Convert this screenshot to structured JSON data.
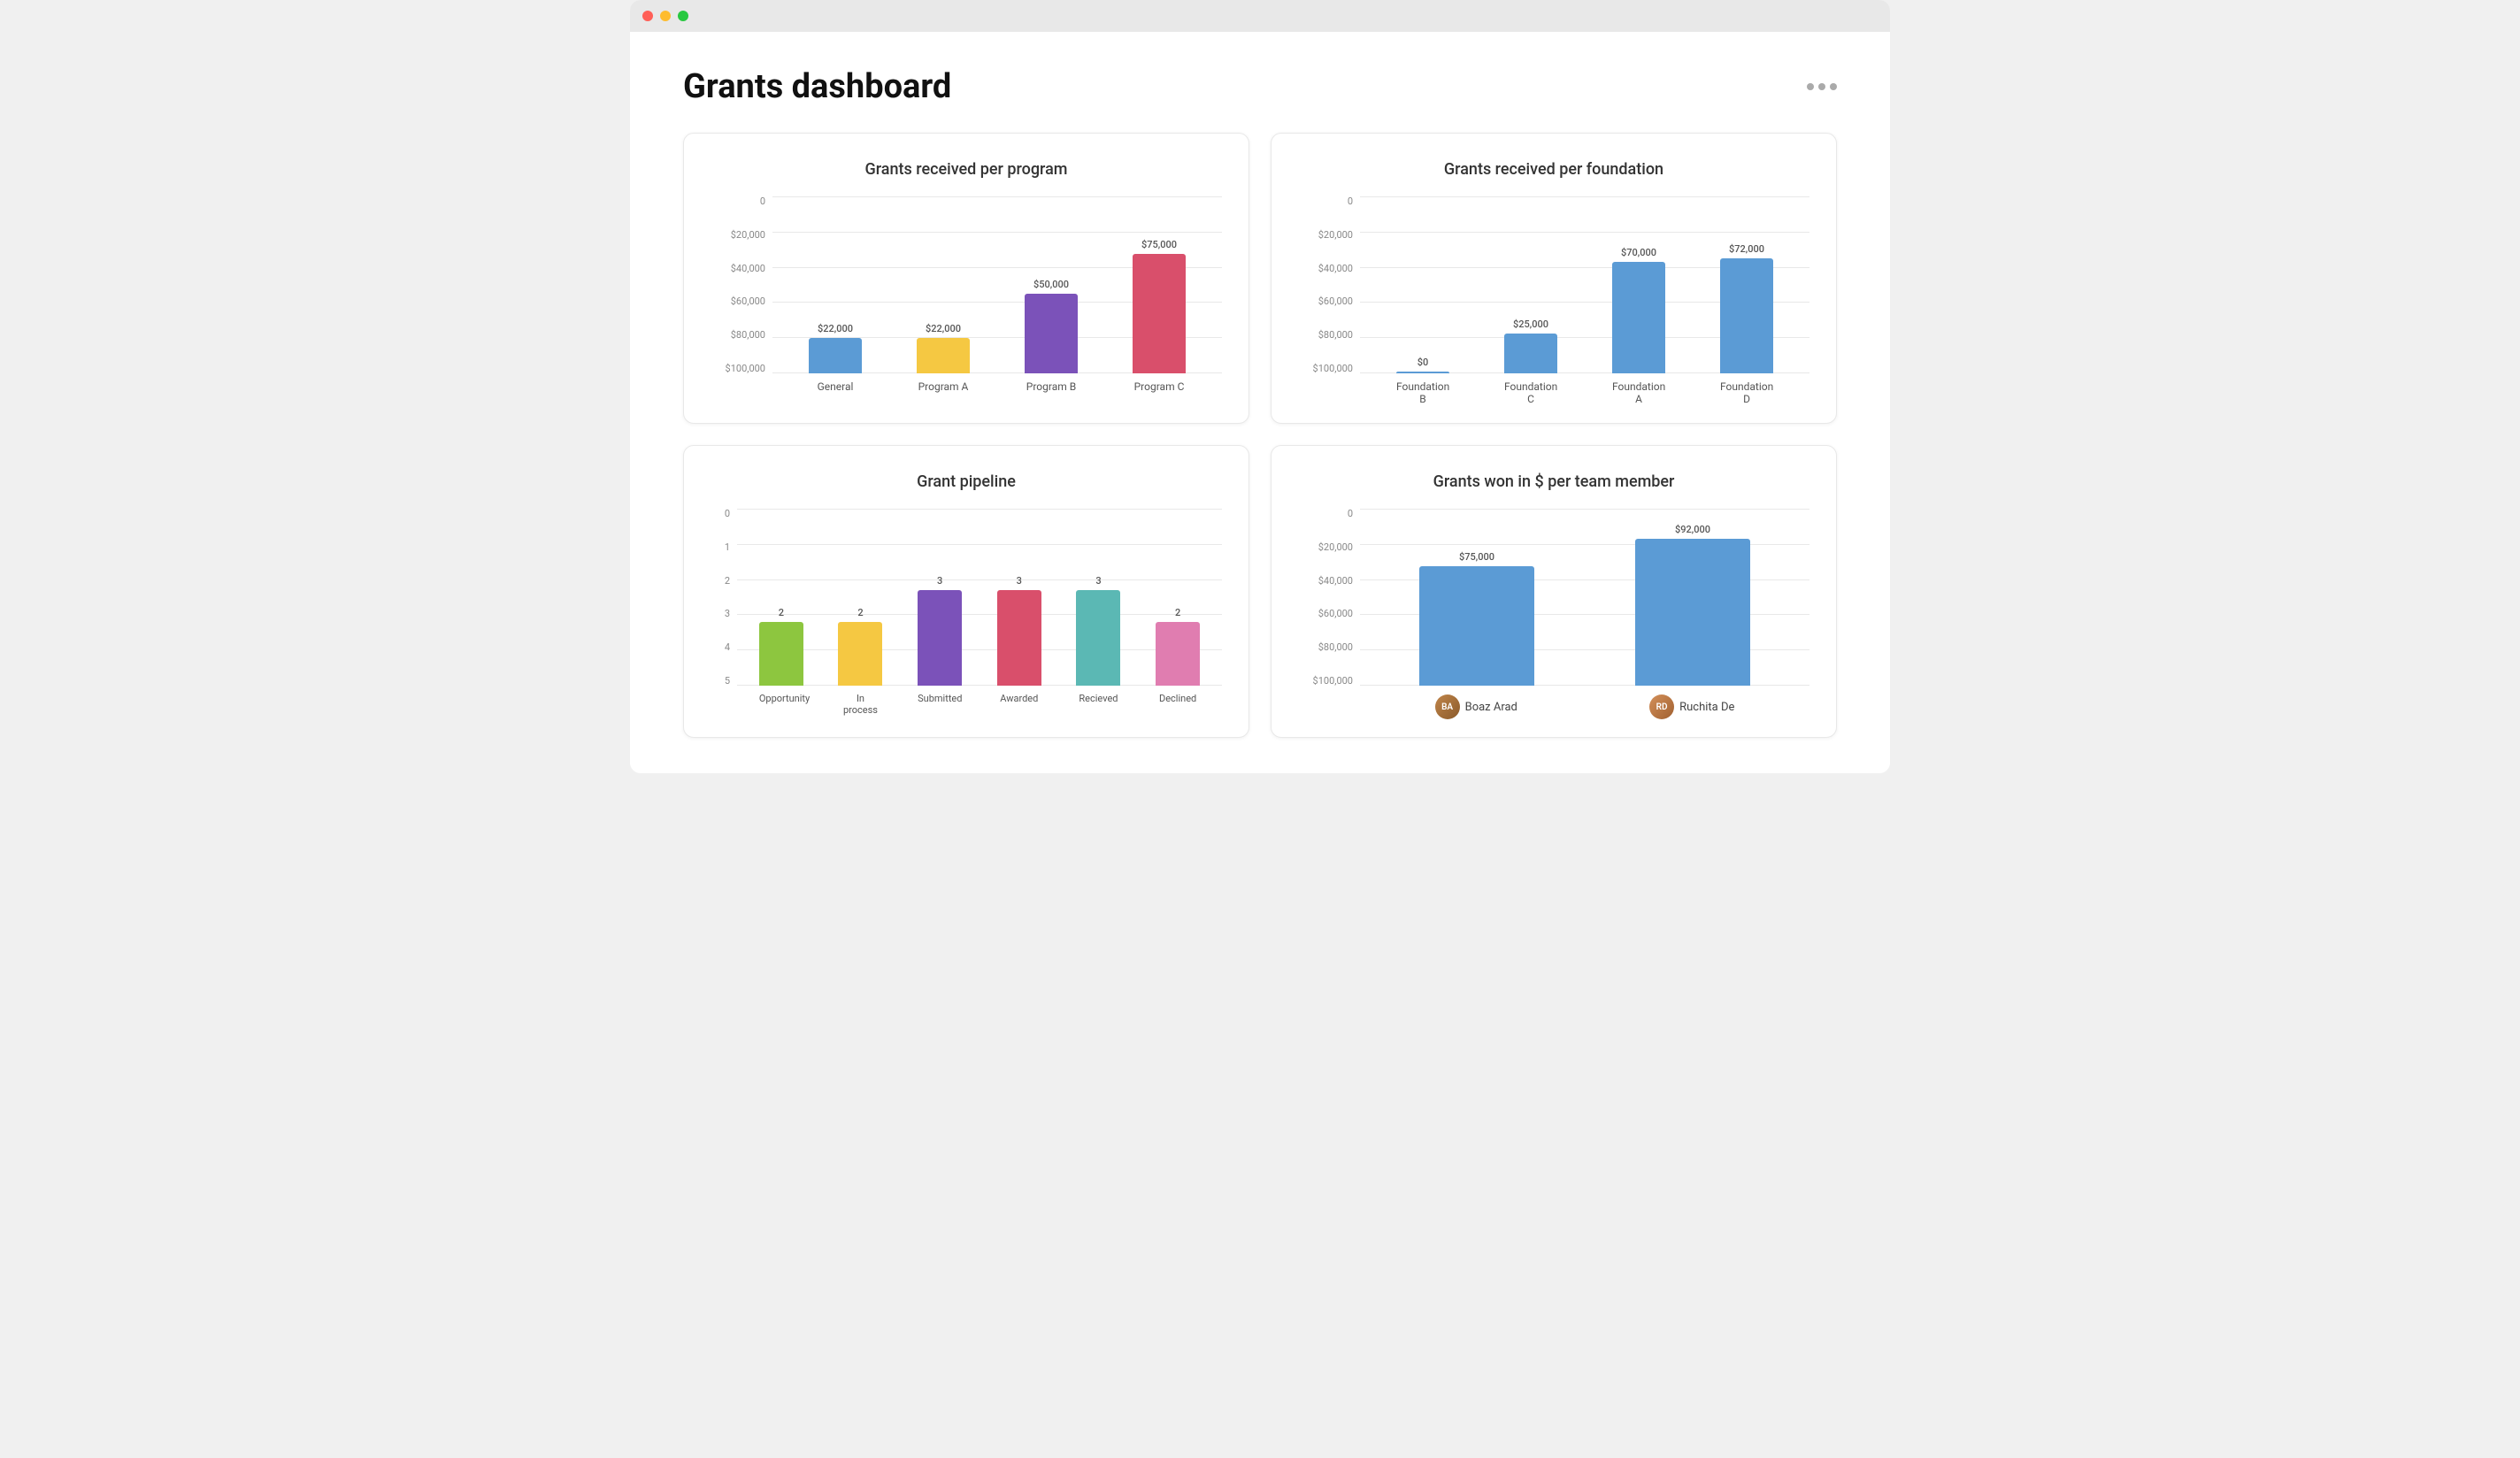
{
  "window": {
    "title": "Grants dashboard"
  },
  "header": {
    "title": "Grants dashboard",
    "more_label": "..."
  },
  "charts": {
    "grants_per_program": {
      "title": "Grants received per program",
      "y_labels": [
        "$100,000",
        "$80,000",
        "$60,000",
        "$40,000",
        "$20,000",
        "0"
      ],
      "bars": [
        {
          "label": "General",
          "value": "$22,000",
          "height_pct": 22,
          "color": "#5b9bd5"
        },
        {
          "label": "Program A",
          "value": "$22,000",
          "height_pct": 22,
          "color": "#f5c842"
        },
        {
          "label": "Program B",
          "value": "$50,000",
          "height_pct": 50,
          "color": "#7b52b9"
        },
        {
          "label": "Program C",
          "value": "$75,000",
          "height_pct": 75,
          "color": "#d94f6b"
        }
      ]
    },
    "grants_per_foundation": {
      "title": "Grants received per foundation",
      "y_labels": [
        "$100,000",
        "$80,000",
        "$60,000",
        "$40,000",
        "$20,000",
        "0"
      ],
      "bars": [
        {
          "label": "Foundation B",
          "value": "$0",
          "height_pct": 0,
          "color": "#5b9bd5"
        },
        {
          "label": "Foundation C",
          "value": "$25,000",
          "height_pct": 25,
          "color": "#5b9bd5"
        },
        {
          "label": "Foundation A",
          "value": "$70,000",
          "height_pct": 70,
          "color": "#5b9bd5"
        },
        {
          "label": "Foundation D",
          "value": "$72,000",
          "height_pct": 72,
          "color": "#5b9bd5"
        }
      ]
    },
    "grant_pipeline": {
      "title": "Grant pipeline",
      "y_labels": [
        "5",
        "4",
        "3",
        "2",
        "1",
        "0"
      ],
      "bars": [
        {
          "label": "Opportunity",
          "value": "2",
          "height_pct": 40,
          "color": "#8dc63f"
        },
        {
          "label": "In process",
          "value": "2",
          "height_pct": 40,
          "color": "#f5c842"
        },
        {
          "label": "Submitted",
          "value": "3",
          "height_pct": 60,
          "color": "#7b52b9"
        },
        {
          "label": "Awarded",
          "value": "3",
          "height_pct": 60,
          "color": "#d94f6b"
        },
        {
          "label": "Recieved",
          "value": "3",
          "height_pct": 60,
          "color": "#5bb8b4"
        },
        {
          "label": "Declined",
          "value": "2",
          "height_pct": 40,
          "color": "#e07db0"
        }
      ]
    },
    "grants_per_member": {
      "title": "Grants won in $ per team member",
      "y_labels": [
        "$100,000",
        "$80,000",
        "$60,000",
        "$40,000",
        "$20,000",
        "0"
      ],
      "bars": [
        {
          "label": "Boaz Arad",
          "value": "$75,000",
          "height_pct": 75,
          "color": "#5b9bd5",
          "initials": "BA",
          "avatar_color": "#a07848"
        },
        {
          "label": "Ruchita De",
          "value": "$92,000",
          "height_pct": 92,
          "color": "#5b9bd5",
          "initials": "RD",
          "avatar_color": "#c07850"
        }
      ]
    }
  }
}
